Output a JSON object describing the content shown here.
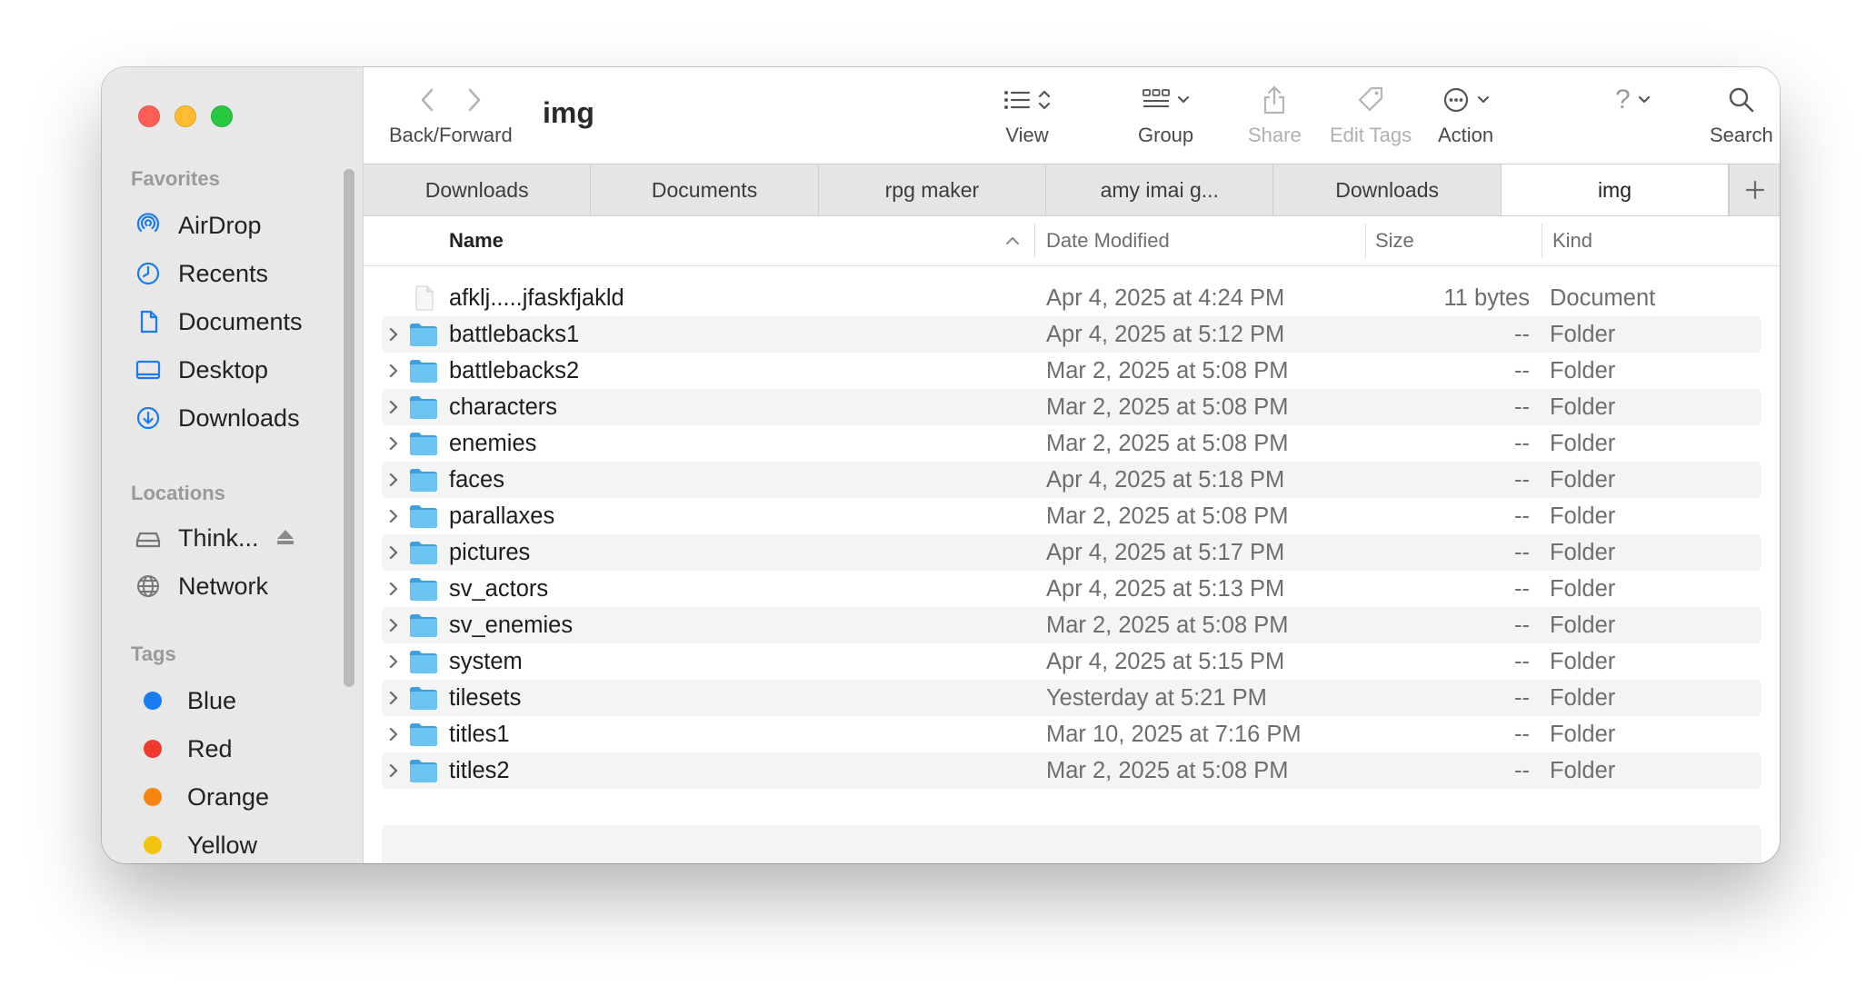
{
  "window": {
    "title": "img"
  },
  "toolbar": {
    "back_forward_label": "Back/Forward",
    "view_label": "View",
    "group_label": "Group",
    "share_label": "Share",
    "edit_tags_label": "Edit Tags",
    "action_label": "Action",
    "help_label": "?",
    "search_label": "Search"
  },
  "sidebar": {
    "favorites_header": "Favorites",
    "favorites": [
      {
        "label": "AirDrop",
        "icon": "airdrop-icon"
      },
      {
        "label": "Recents",
        "icon": "clock-icon"
      },
      {
        "label": "Documents",
        "icon": "document-icon"
      },
      {
        "label": "Desktop",
        "icon": "desktop-icon"
      },
      {
        "label": "Downloads",
        "icon": "downloads-icon"
      }
    ],
    "locations_header": "Locations",
    "locations": [
      {
        "label": "Think...",
        "icon": "drive-icon"
      },
      {
        "label": "Network",
        "icon": "globe-icon"
      }
    ],
    "tags_header": "Tags",
    "tags": [
      {
        "label": "Blue",
        "color": "#1a7cf5"
      },
      {
        "label": "Red",
        "color": "#f03a2e"
      },
      {
        "label": "Orange",
        "color": "#f5850f"
      },
      {
        "label": "Yellow",
        "color": "#f2c40f"
      }
    ]
  },
  "tabs": [
    {
      "label": "Downloads",
      "active": false
    },
    {
      "label": "Documents",
      "active": false
    },
    {
      "label": "rpg maker",
      "active": false
    },
    {
      "label": "amy imai g...",
      "active": false
    },
    {
      "label": "Downloads",
      "active": false
    },
    {
      "label": "img",
      "active": true
    }
  ],
  "columns": {
    "name": "Name",
    "date": "Date Modified",
    "size": "Size",
    "kind": "Kind"
  },
  "files": [
    {
      "name": "afklj.....jfaskfjakld",
      "date": "Apr 4, 2025 at 4:24 PM",
      "size": "11 bytes",
      "kind": "Document",
      "type": "document"
    },
    {
      "name": "battlebacks1",
      "date": "Apr 4, 2025 at 5:12 PM",
      "size": "--",
      "kind": "Folder",
      "type": "folder"
    },
    {
      "name": "battlebacks2",
      "date": "Mar 2, 2025 at 5:08 PM",
      "size": "--",
      "kind": "Folder",
      "type": "folder"
    },
    {
      "name": "characters",
      "date": "Mar 2, 2025 at 5:08 PM",
      "size": "--",
      "kind": "Folder",
      "type": "folder"
    },
    {
      "name": "enemies",
      "date": "Mar 2, 2025 at 5:08 PM",
      "size": "--",
      "kind": "Folder",
      "type": "folder"
    },
    {
      "name": "faces",
      "date": "Apr 4, 2025 at 5:18 PM",
      "size": "--",
      "kind": "Folder",
      "type": "folder"
    },
    {
      "name": "parallaxes",
      "date": "Mar 2, 2025 at 5:08 PM",
      "size": "--",
      "kind": "Folder",
      "type": "folder"
    },
    {
      "name": "pictures",
      "date": "Apr 4, 2025 at 5:17 PM",
      "size": "--",
      "kind": "Folder",
      "type": "folder"
    },
    {
      "name": "sv_actors",
      "date": "Apr 4, 2025 at 5:13 PM",
      "size": "--",
      "kind": "Folder",
      "type": "folder"
    },
    {
      "name": "sv_enemies",
      "date": "Mar 2, 2025 at 5:08 PM",
      "size": "--",
      "kind": "Folder",
      "type": "folder"
    },
    {
      "name": "system",
      "date": "Apr 4, 2025 at 5:15 PM",
      "size": "--",
      "kind": "Folder",
      "type": "folder"
    },
    {
      "name": "tilesets",
      "date": "Yesterday at 5:21 PM",
      "size": "--",
      "kind": "Folder",
      "type": "folder"
    },
    {
      "name": "titles1",
      "date": "Mar 10, 2025 at 7:16 PM",
      "size": "--",
      "kind": "Folder",
      "type": "folder"
    },
    {
      "name": "titles2",
      "date": "Mar 2, 2025 at 5:08 PM",
      "size": "--",
      "kind": "Folder",
      "type": "folder"
    }
  ],
  "colors": {
    "accent": "#1a7cf5",
    "folder": "#5bb8ec"
  }
}
